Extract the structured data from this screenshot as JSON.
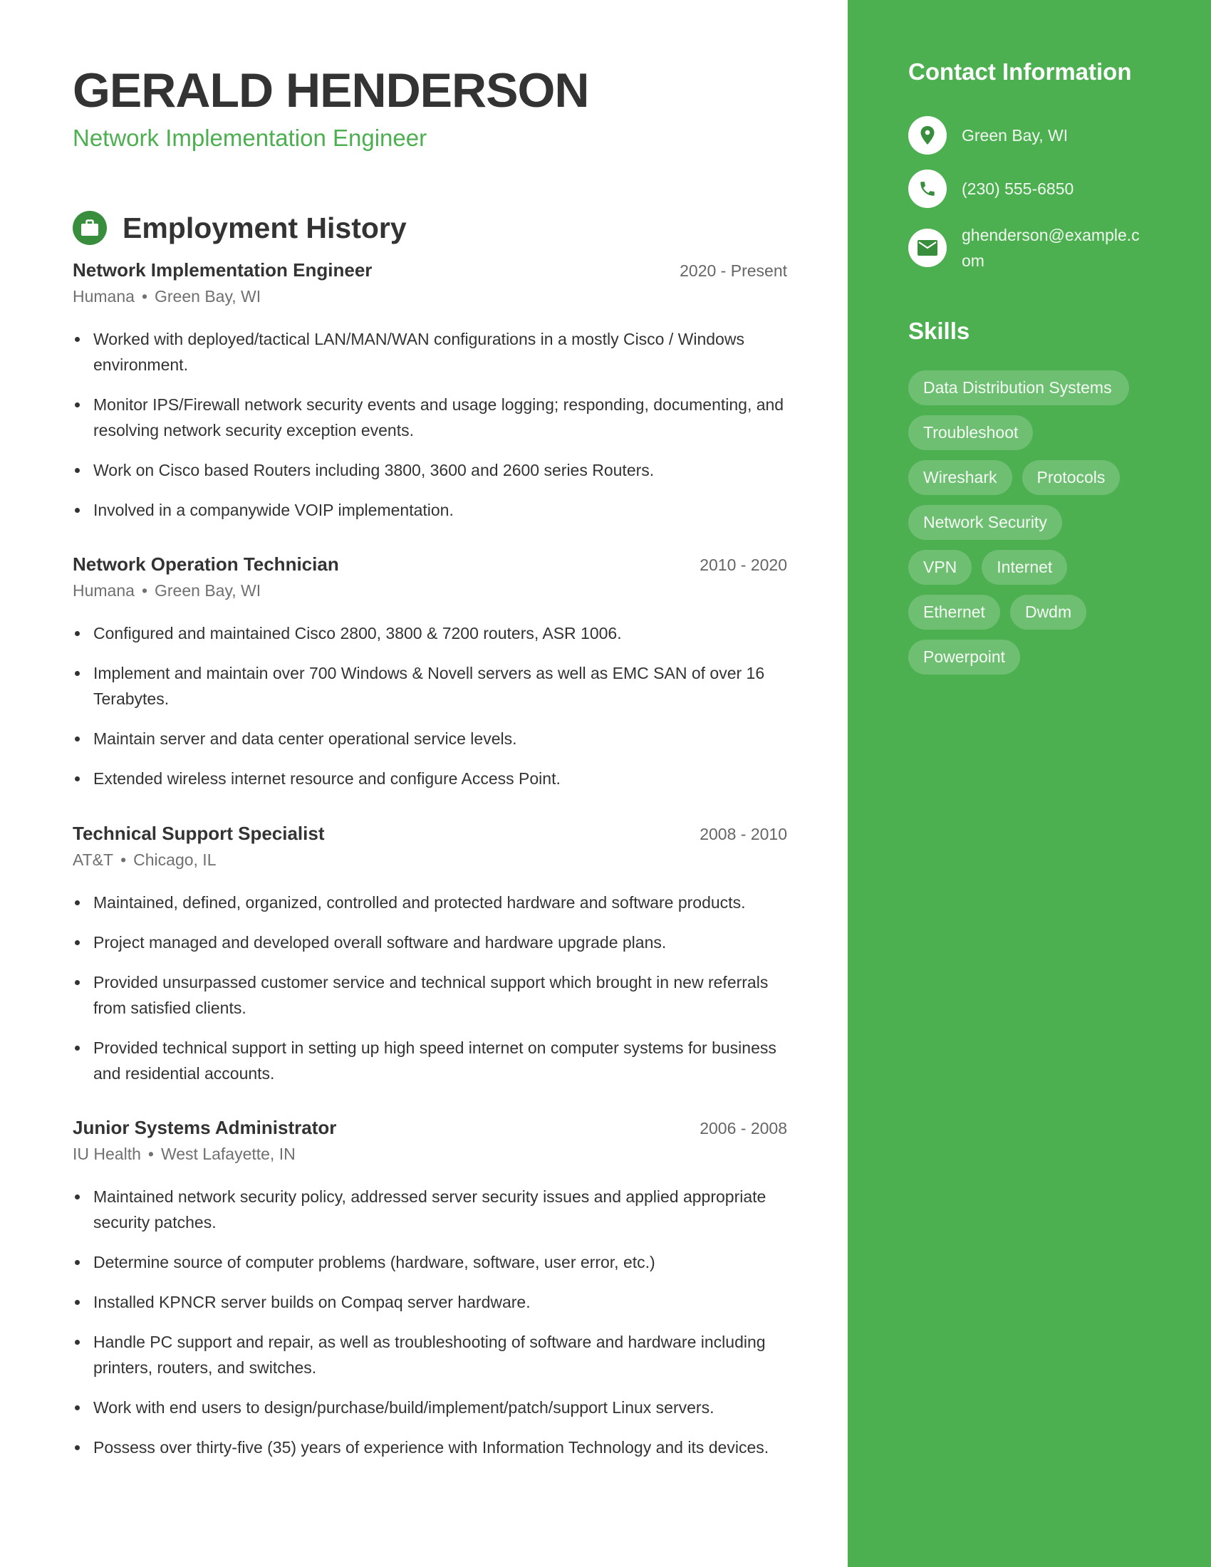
{
  "header": {
    "name": "GERALD HENDERSON",
    "title": "Network Implementation Engineer"
  },
  "employment": {
    "section_title": "Employment History",
    "section_icon": "briefcase-icon",
    "jobs": [
      {
        "title": "Network Implementation Engineer",
        "dates": "2020 - Present",
        "company": "Humana",
        "location": "Green Bay, WI",
        "bullets": [
          "Worked with deployed/tactical LAN/MAN/WAN configurations in a mostly Cisco / Windows environment.",
          "Monitor IPS/Firewall network security events and usage logging; responding, documenting, and resolving network security exception events.",
          "Work on Cisco based Routers including 3800, 3600 and 2600 series Routers.",
          "Involved in a companywide VOIP implementation."
        ]
      },
      {
        "title": "Network Operation Technician",
        "dates": "2010 - 2020",
        "company": "Humana",
        "location": "Green Bay, WI",
        "bullets": [
          "Configured and maintained Cisco 2800, 3800 & 7200 routers, ASR 1006.",
          "Implement and maintain over 700 Windows & Novell servers as well as EMC SAN of over 16 Terabytes.",
          "Maintain server and data center operational service levels.",
          "Extended wireless internet resource and configure Access Point."
        ]
      },
      {
        "title": "Technical Support Specialist",
        "dates": "2008 - 2010",
        "company": "AT&T",
        "location": "Chicago, IL",
        "bullets": [
          "Maintained, defined, organized, controlled and protected hardware and software products.",
          "Project managed and developed overall software and hardware upgrade plans.",
          "Provided unsurpassed customer service and technical support which brought in new referrals from satisfied clients.",
          "Provided technical support in setting up high speed internet on computer systems for business and residential accounts."
        ]
      },
      {
        "title": "Junior Systems Administrator",
        "dates": "2006 - 2008",
        "company": "IU Health",
        "location": "West Lafayette, IN",
        "bullets": [
          "Maintained network security policy, addressed server security issues and applied appropriate security patches.",
          "Determine source of computer problems (hardware, software, user error, etc.)",
          "Installed KPNCR server builds on Compaq server hardware.",
          "Handle PC support and repair, as well as troubleshooting of software and hardware including printers, routers, and switches.",
          "Work with end users to design/purchase/build/implement/patch/support Linux servers.",
          "Possess over thirty-five (35) years of experience with Information Technology and its devices."
        ]
      }
    ]
  },
  "sidebar": {
    "contact_title": "Contact Information",
    "contact": [
      {
        "icon": "location-pin-icon",
        "text": "Green Bay, WI"
      },
      {
        "icon": "phone-icon",
        "text": "(230) 555-6850"
      },
      {
        "icon": "email-icon",
        "text": "ghenderson@example.com"
      }
    ],
    "skills_title": "Skills",
    "skills": [
      "Data Distribution Systems",
      "Troubleshoot",
      "Wireshark",
      "Protocols",
      "Network Security",
      "VPN",
      "Internet",
      "Ethernet",
      "Dwdm",
      "Powerpoint"
    ]
  },
  "colors": {
    "accent": "#4caf50",
    "accent_dark": "#388e3c",
    "text": "#333333"
  }
}
